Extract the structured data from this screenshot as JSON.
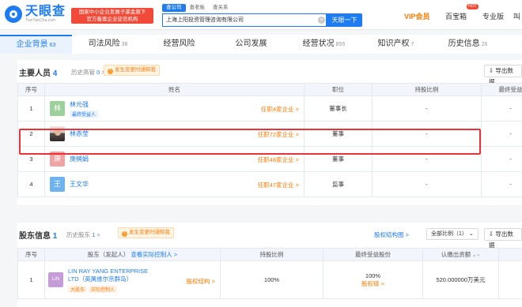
{
  "header": {
    "logo_cn": "天眼查",
    "logo_en": "TianYanCha.com",
    "banner_line1": "国家中小企业发展子基金旗下",
    "banner_line2": "官方备案企业征信机构",
    "search_tabs": [
      "查公司",
      "查老板",
      "查关系"
    ],
    "search_value": "上海上阳投资管理咨询有限公司",
    "search_button": "天眼一下",
    "vip": "VIP会员",
    "biz": "百宝箱",
    "hot": "HOT",
    "pro": "专业版",
    "more": "叫"
  },
  "tabs": [
    {
      "label": "企业背景",
      "count": "63"
    },
    {
      "label": "司法风险",
      "count": "38"
    },
    {
      "label": "经营风险",
      "count": ""
    },
    {
      "label": "公司发展",
      "count": ""
    },
    {
      "label": "经营状况",
      "count": "855"
    },
    {
      "label": "知识产权",
      "count": "7"
    },
    {
      "label": "历史信息",
      "count": "26"
    }
  ],
  "personnel": {
    "title": "主要人员",
    "count": "4",
    "history_label": "历史高管",
    "history_count": "0",
    "change_label": "发生变更时通知我",
    "export_label": "导出数据",
    "columns": [
      "序号",
      "姓名",
      "职位",
      "持股比例",
      "最终受益"
    ],
    "rows": [
      {
        "idx": "1",
        "avatar": "林",
        "avatar_color": "#9cd09a",
        "name": "林元强",
        "tag": "最终受益人",
        "held": "任职4家企业",
        "position": "董事长",
        "ratio": "-",
        "benefit": "-"
      },
      {
        "idx": "2",
        "avatar": "",
        "avatar_color": "",
        "name": "林赤莹",
        "tag": "",
        "held": "任职72家企业",
        "position": "董事",
        "ratio": "-",
        "benefit": "-"
      },
      {
        "idx": "3",
        "avatar": "庚",
        "avatar_color": "#f0a3a3",
        "name": "庚楠娟",
        "tag": "",
        "held": "任职48家企业",
        "position": "董事",
        "ratio": "-",
        "benefit": "-"
      },
      {
        "idx": "4",
        "avatar": "王",
        "avatar_color": "#6eb3ef",
        "name": "王文华",
        "tag": "",
        "held": "任职47家企业",
        "position": "监事",
        "ratio": "-",
        "benefit": "-"
      }
    ]
  },
  "shareholders": {
    "title": "股东信息",
    "count": "1",
    "history_label": "历史股东",
    "history_count": "1",
    "change_label": "发生变更时通知我",
    "structure_link": "股权结构图",
    "select_label": "全部比例（1）",
    "export_label": "导出数据",
    "columns": [
      "序号",
      "股东（发起人）",
      "查看实际控制人",
      "持股比例",
      "最终受益股份",
      "认缴出资额"
    ],
    "rows": [
      {
        "idx": "1",
        "logo": "LIN",
        "name": "LIN RAY YANG ENTERPRISE LTD（英属维尔京群岛）",
        "tags": [
          "大股东",
          "实际控制人"
        ],
        "equity": "股权结构",
        "ratio": "100%",
        "benefit": "100%",
        "benefit_link": "股权链",
        "capital": "520.000000万美元"
      }
    ]
  }
}
